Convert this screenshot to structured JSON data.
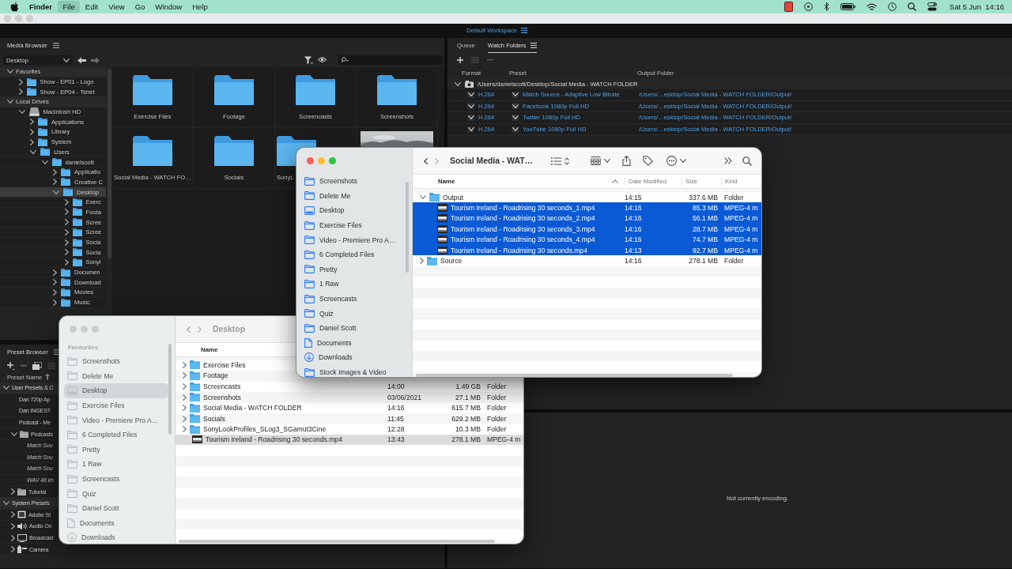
{
  "menubar": {
    "app": "Finder",
    "menus": [
      {
        "label": "File",
        "selected": true
      },
      {
        "label": "Edit",
        "selected": false
      },
      {
        "label": "View",
        "selected": false
      },
      {
        "label": "Go",
        "selected": false
      },
      {
        "label": "Window",
        "selected": false
      },
      {
        "label": "Help",
        "selected": false
      }
    ],
    "clock": "Sat 5 Jun  14:16"
  },
  "encoder": {
    "workspace": "Default Workspace",
    "media_browser": {
      "title": "Media Browser",
      "location": "Desktop",
      "tree": [
        {
          "label": "Favorites",
          "kind": "group",
          "expanded": true,
          "selected": false,
          "children": [
            {
              "label": "Show - EP01 - Logo",
              "kind": "folder",
              "expanded": false,
              "selected": false
            },
            {
              "label": "Show - EP04 - Tshirt",
              "kind": "folder",
              "expanded": false,
              "selected": false
            }
          ]
        },
        {
          "label": "Local Drives",
          "kind": "group",
          "expanded": true,
          "selected": false,
          "children": [
            {
              "label": "Macintosh HD",
              "kind": "drive",
              "expanded": true,
              "selected": false,
              "children": [
                {
                  "label": "Applications",
                  "kind": "folder",
                  "expanded": false,
                  "selected": false
                },
                {
                  "label": "Library",
                  "kind": "folder",
                  "expanded": false,
                  "selected": false
                },
                {
                  "label": "System",
                  "kind": "folder",
                  "expanded": false,
                  "selected": false
                },
                {
                  "label": "Users",
                  "kind": "folder",
                  "expanded": true,
                  "selected": false,
                  "children": [
                    {
                      "label": "danielscott",
                      "kind": "folder",
                      "expanded": true,
                      "selected": false,
                      "children": [
                        {
                          "label": "Applicatio",
                          "kind": "folder",
                          "expanded": false,
                          "selected": false
                        },
                        {
                          "label": "Creative C",
                          "kind": "folder",
                          "expanded": false,
                          "selected": false
                        },
                        {
                          "label": "Desktop",
                          "kind": "folder",
                          "expanded": true,
                          "selected": true,
                          "children": [
                            {
                              "label": "Exerc",
                              "kind": "folder",
                              "expanded": false,
                              "selected": false
                            },
                            {
                              "label": "Foota",
                              "kind": "folder",
                              "expanded": false,
                              "selected": false
                            },
                            {
                              "label": "Scree",
                              "kind": "folder",
                              "expanded": false,
                              "selected": false
                            },
                            {
                              "label": "Scree",
                              "kind": "folder",
                              "expanded": false,
                              "selected": false
                            },
                            {
                              "label": "Socia",
                              "kind": "folder",
                              "expanded": false,
                              "selected": false
                            },
                            {
                              "label": "Socia",
                              "kind": "folder",
                              "expanded": false,
                              "selected": false
                            },
                            {
                              "label": "Sonyl",
                              "kind": "folder",
                              "expanded": false,
                              "selected": false
                            }
                          ]
                        },
                        {
                          "label": "Documen",
                          "kind": "folder",
                          "expanded": false,
                          "selected": false
                        },
                        {
                          "label": "Download",
                          "kind": "folder",
                          "expanded": false,
                          "selected": false
                        },
                        {
                          "label": "Movies",
                          "kind": "folder",
                          "expanded": false,
                          "selected": false
                        },
                        {
                          "label": "Music",
                          "kind": "folder",
                          "expanded": false,
                          "selected": false
                        }
                      ]
                    }
                  ]
                }
              ]
            }
          ]
        }
      ],
      "grid": [
        {
          "name": "Exercise Files",
          "kind": "folder"
        },
        {
          "name": "Footage",
          "kind": "folder"
        },
        {
          "name": "Screencasts",
          "kind": "folder"
        },
        {
          "name": "Screenshots",
          "kind": "folder"
        },
        {
          "name": "Social Media - WATCH FO…",
          "kind": "folder"
        },
        {
          "name": "Socials",
          "kind": "folder"
        },
        {
          "name": "SonyL",
          "kind": "folder"
        },
        {
          "kind": "picture"
        }
      ]
    },
    "preset_browser": {
      "title": "Preset Browser",
      "column": "Preset Name",
      "tree": [
        {
          "label": "User Presets & C",
          "kind": "group",
          "expanded": true,
          "children": [
            {
              "label": "Dan 720p Ap",
              "kind": "preset"
            },
            {
              "label": "Dan INGEST",
              "kind": "preset"
            },
            {
              "label": "Podcast - Me",
              "kind": "preset"
            },
            {
              "label": "Podcasts",
              "kind": "folder",
              "expanded": true,
              "children": [
                {
                  "label": "Match Sou",
                  "kind": "template"
                },
                {
                  "label": "Match Sou",
                  "kind": "template"
                },
                {
                  "label": "Match Sou",
                  "kind": "template"
                },
                {
                  "label": "WAV 48 kh",
                  "kind": "template"
                }
              ]
            },
            {
              "label": "Tutorial",
              "kind": "folder",
              "expanded": false
            }
          ]
        },
        {
          "label": "System Presets",
          "kind": "group",
          "expanded": true,
          "children": [
            {
              "label": "Adobe St",
              "kind": "stock",
              "expanded": false
            },
            {
              "label": "Audio On",
              "kind": "audio",
              "expanded": false
            },
            {
              "label": "Broadcast",
              "kind": "broadcast",
              "expanded": false
            },
            {
              "label": "Camera",
              "kind": "camera",
              "expanded": false
            }
          ]
        }
      ]
    },
    "tabs": [
      {
        "label": "Queue",
        "selected": false
      },
      {
        "label": "Watch Folders",
        "selected": true
      }
    ],
    "watch_columns": [
      "Format",
      "Preset",
      "Output Folder"
    ],
    "watch_folder": {
      "path": "/Users/danielscott/Desktop/Social Media - WATCH FOLDER",
      "expanded": true,
      "outputs": [
        {
          "format": "H.264",
          "preset": "Match Source - Adaptive Low Bitrate",
          "output": "/Users/…esktop/Social Media - WATCH FOLDER/Output/"
        },
        {
          "format": "H.264",
          "preset": "Facebook 1080p Full HD",
          "output": "/Users/…esktop/Social Media - WATCH FOLDER/Output/"
        },
        {
          "format": "H.264",
          "preset": "Twitter 1080p Full HD",
          "output": "/Users/…esktop/Social Media - WATCH FOLDER/Output/"
        },
        {
          "format": "H.264",
          "preset": "YouTube 1080p Full HD",
          "output": "/Users/…esktop/Social Media - WATCH FOLDER/Output/"
        }
      ]
    },
    "encoding_status": "Not currently encoding."
  },
  "finders": [
    {
      "active": false,
      "title": "Desktop",
      "sidebar_heading": "Favourites",
      "sidebar": [
        {
          "label": "Screenshots",
          "kind": "folder",
          "selected": false
        },
        {
          "label": "Delete Me",
          "kind": "folder",
          "selected": false
        },
        {
          "label": "Desktop",
          "kind": "desktop",
          "selected": true
        },
        {
          "label": "Exercise Files",
          "kind": "folder",
          "selected": false
        },
        {
          "label": "Video - Premiere Pro A…",
          "kind": "folder",
          "selected": false
        },
        {
          "label": "6 Completed Files",
          "kind": "folder",
          "selected": false
        },
        {
          "label": "Pretty",
          "kind": "folder",
          "selected": false
        },
        {
          "label": "1 Raw",
          "kind": "folder",
          "selected": false
        },
        {
          "label": "Screencasts",
          "kind": "folder",
          "selected": false
        },
        {
          "label": "Quiz",
          "kind": "folder",
          "selected": false
        },
        {
          "label": "Daniel Scott",
          "kind": "folder",
          "selected": false
        },
        {
          "label": "Documents",
          "kind": "document",
          "selected": false
        },
        {
          "label": "Downloads",
          "kind": "download",
          "selected": false
        }
      ],
      "columns": [
        "Name"
      ],
      "rows": [
        {
          "name": "Exercise Files",
          "kind": "folder",
          "expanded": false,
          "selected": false
        },
        {
          "name": "Footage",
          "kind": "folder",
          "expanded": false,
          "selected": false
        },
        {
          "name": "Screencasts",
          "kind": "folder",
          "expanded": false,
          "selected": false,
          "date": "14:00",
          "size": "1.49 GB",
          "type": "Folder"
        },
        {
          "name": "Screenshots",
          "kind": "folder",
          "expanded": false,
          "selected": false,
          "date": "03/06/2021",
          "size": "27.1 MB",
          "type": "Folder"
        },
        {
          "name": "Social Media - WATCH FOLDER",
          "kind": "folder",
          "expanded": false,
          "selected": false,
          "date": "14:16",
          "size": "615.7 MB",
          "type": "Folder"
        },
        {
          "name": "Socials",
          "kind": "folder",
          "expanded": false,
          "selected": false,
          "date": "11:45",
          "size": "629.2 MB",
          "type": "Folder"
        },
        {
          "name": "SonyLookProfiles_SLog3_SGamut3Cine",
          "kind": "folder",
          "expanded": false,
          "selected": false,
          "date": "12:28",
          "size": "10.3 MB",
          "type": "Folder"
        },
        {
          "name": "Tourism Ireland - Roadrising 30 seconds.mp4",
          "kind": "video",
          "selected": true,
          "date": "13:43",
          "size": "278.1 MB",
          "type": "MPEG-4 m"
        }
      ]
    },
    {
      "active": true,
      "title": "Social Media - WAT…",
      "sort_ascending": true,
      "sidebar": [
        {
          "label": "Screenshots",
          "kind": "folder",
          "selected": false
        },
        {
          "label": "Delete Me",
          "kind": "folder",
          "selected": false
        },
        {
          "label": "Desktop",
          "kind": "desktop",
          "selected": false
        },
        {
          "label": "Exercise Files",
          "kind": "folder",
          "selected": false
        },
        {
          "label": "Video - Premiere Pro A…",
          "kind": "folder",
          "selected": false
        },
        {
          "label": "6 Completed Files",
          "kind": "folder",
          "selected": false
        },
        {
          "label": "Pretty",
          "kind": "folder",
          "selected": false
        },
        {
          "label": "1 Raw",
          "kind": "folder",
          "selected": false
        },
        {
          "label": "Screencasts",
          "kind": "folder",
          "selected": false
        },
        {
          "label": "Quiz",
          "kind": "folder",
          "selected": false
        },
        {
          "label": "Daniel Scott",
          "kind": "folder",
          "selected": false
        },
        {
          "label": "Documents",
          "kind": "document",
          "selected": false
        },
        {
          "label": "Downloads",
          "kind": "download",
          "selected": false
        },
        {
          "label": "Stock Images & Video",
          "kind": "folder",
          "selected": false
        }
      ],
      "columns": [
        "Name",
        "Date Modified",
        "Size",
        "Kind"
      ],
      "rows": [
        {
          "name": "Output",
          "kind": "folder",
          "expanded": true,
          "selected": false,
          "date": "14:15",
          "size": "337.6 MB",
          "type": "Folder",
          "children": [
            {
              "name": "Tourism Ireland - Roadrising 30 seconds_1.mp4",
              "kind": "video",
              "selected": true,
              "date": "14:16",
              "size": "85.3 MB",
              "type": "MPEG-4 m"
            },
            {
              "name": "Tourism Ireland - Roadrising 30 seconds_2.mp4",
              "kind": "video",
              "selected": true,
              "date": "14:16",
              "size": "56.1 MB",
              "type": "MPEG-4 m"
            },
            {
              "name": "Tourism Ireland - Roadrising 30 seconds_3.mp4",
              "kind": "video",
              "selected": true,
              "date": "14:16",
              "size": "28.7 MB",
              "type": "MPEG-4 m"
            },
            {
              "name": "Tourism Ireland - Roadrising 30 seconds_4.mp4",
              "kind": "video",
              "selected": true,
              "date": "14:16",
              "size": "74.7 MB",
              "type": "MPEG-4 m"
            },
            {
              "name": "Tourism Ireland - Roadrising 30 seconds.mp4",
              "kind": "video",
              "selected": true,
              "date": "14:13",
              "size": "92.7 MB",
              "type": "MPEG-4 m"
            }
          ]
        },
        {
          "name": "Source",
          "kind": "folder",
          "expanded": false,
          "selected": false,
          "date": "14:16",
          "size": "278.1 MB",
          "type": "Folder"
        }
      ]
    }
  ]
}
